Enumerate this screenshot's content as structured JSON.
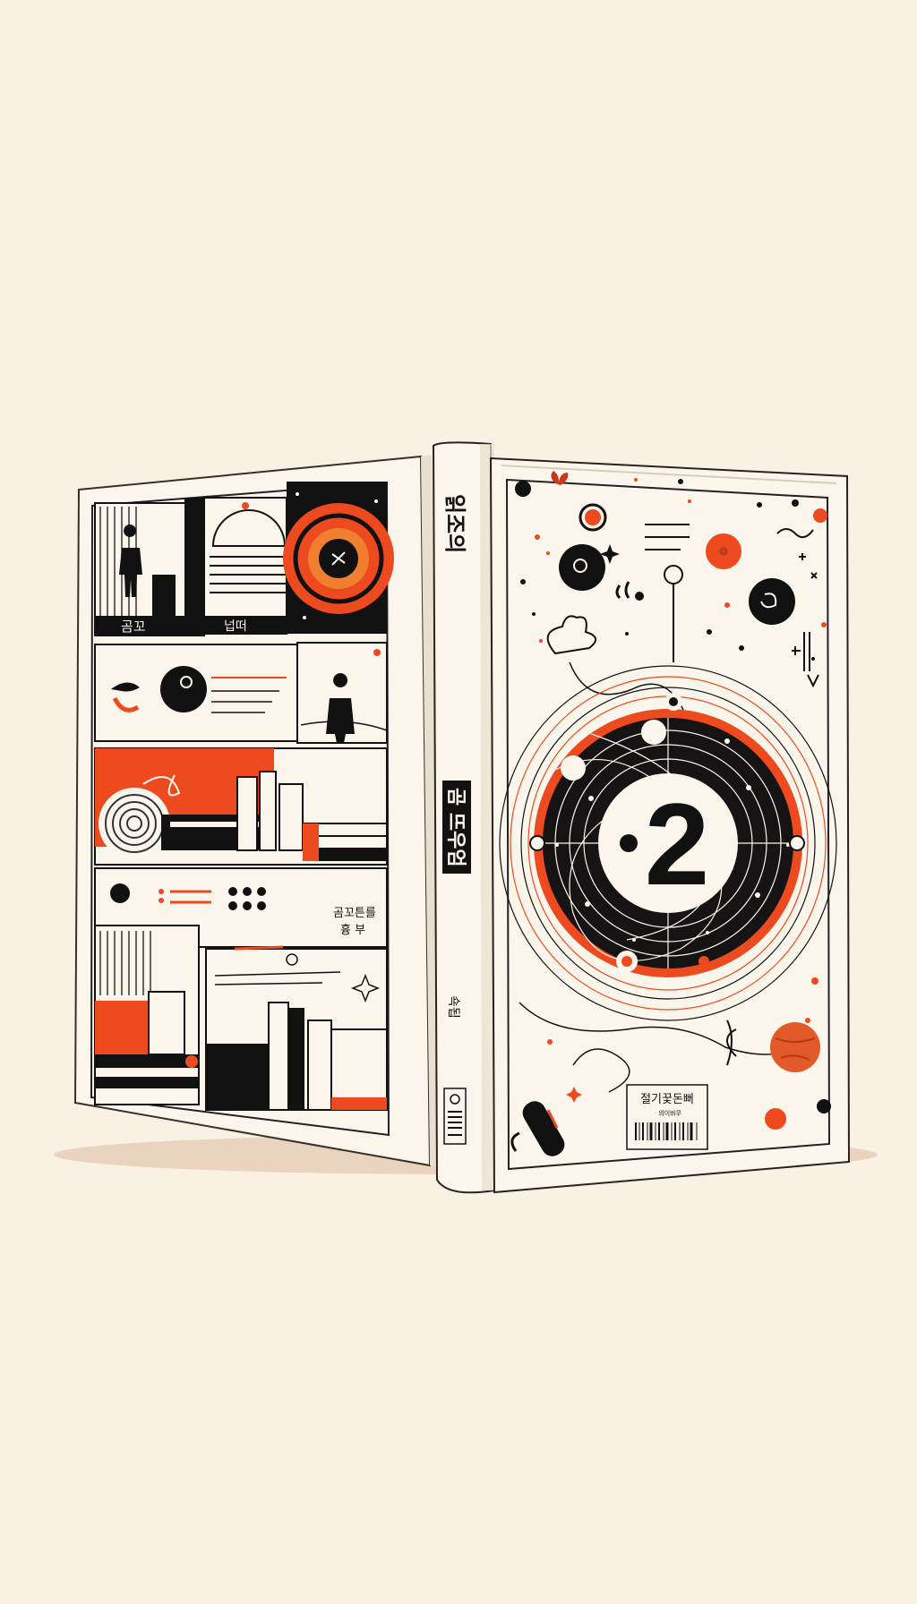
{
  "palette": {
    "background": "#f8f1e4",
    "paper": "#fbf6ec",
    "ink": "#151313",
    "accent_orange": "#ee4a1f",
    "accent_deep": "#e35a2a",
    "shadow": "#e2c6ad"
  },
  "back_cover": {
    "panel_top_label": "곰꼬",
    "panel_top_label_2": "넙떠",
    "bottom_text_line_1": "곰꼬튼를",
    "bottom_text_line_2": "흉 부"
  },
  "spine": {
    "title_top": "읽조의",
    "title_boxed": "곰 뜨우엄",
    "publisher": "쇽됩"
  },
  "front_cover": {
    "big_number": "2",
    "label_text": "절기꿏돈뻐",
    "label_subtext": "ᆞ의이바무"
  },
  "icons": [
    "barcode-icon",
    "planet-icon",
    "figure-silhouette-icon",
    "flower-icon",
    "butterfly-icon",
    "star-sparkle-icon"
  ]
}
